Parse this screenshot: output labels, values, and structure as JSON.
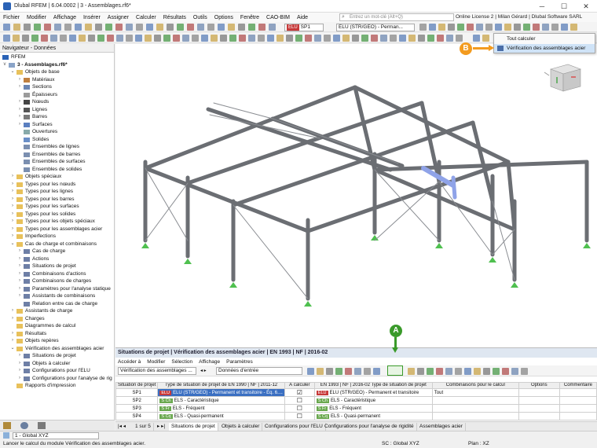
{
  "title": "Dlubal RFEM | 6.04.0002 | 3 - Assemblages.rf6*",
  "menu": [
    "Fichier",
    "Modifier",
    "Affichage",
    "Insérer",
    "Assigner",
    "Calculer",
    "Résultats",
    "Outils",
    "Options",
    "Fenêtre",
    "CAO-BIM",
    "Aide"
  ],
  "search_placeholder": "Entrez un mot-clé (Alt+Q)",
  "license": "Online License 2 | Milan Gérard | Dlubal Software SARL",
  "toolbar": {
    "loadcase_badge": "ELU",
    "loadcase_code": "SP1",
    "loadcase_name": "ELU (STR/GEO) - Perman..."
  },
  "popup": {
    "item1": "Tout calculer",
    "item2": "Vérification des assemblages acier"
  },
  "callouts": {
    "a": "A",
    "b": "B"
  },
  "navigator": {
    "title": "Navigateur - Données",
    "root": "RFEM",
    "file": "3 - Assemblages.rf6*",
    "items": [
      {
        "label": "Objets de base",
        "lvl": 1,
        "ex": "v",
        "ic": "folder"
      },
      {
        "label": "Matériaux",
        "lvl": 2,
        "ex": ">",
        "ic": "mat"
      },
      {
        "label": "Sections",
        "lvl": 2,
        "ex": ">",
        "ic": "sec"
      },
      {
        "label": "Épaisseurs",
        "lvl": 2,
        "ex": "",
        "ic": "thk"
      },
      {
        "label": "Nœuds",
        "lvl": 2,
        "ex": ">",
        "ic": "node"
      },
      {
        "label": "Lignes",
        "lvl": 2,
        "ex": ">",
        "ic": "line"
      },
      {
        "label": "Barres",
        "lvl": 2,
        "ex": ">",
        "ic": "bar"
      },
      {
        "label": "Surfaces",
        "lvl": 2,
        "ex": ">",
        "ic": "surf"
      },
      {
        "label": "Ouvertures",
        "lvl": 2,
        "ex": "",
        "ic": "open"
      },
      {
        "label": "Solides",
        "lvl": 2,
        "ex": "",
        "ic": "solid"
      },
      {
        "label": "Ensembles de lignes",
        "lvl": 2,
        "ex": "",
        "ic": "set"
      },
      {
        "label": "Ensembles de barres",
        "lvl": 2,
        "ex": "",
        "ic": "set"
      },
      {
        "label": "Ensembles de surfaces",
        "lvl": 2,
        "ex": "",
        "ic": "set"
      },
      {
        "label": "Ensembles de solides",
        "lvl": 2,
        "ex": "",
        "ic": "set"
      },
      {
        "label": "Objets spéciaux",
        "lvl": 1,
        "ex": ">",
        "ic": "folder"
      },
      {
        "label": "Types pour les nœuds",
        "lvl": 1,
        "ex": ">",
        "ic": "folder"
      },
      {
        "label": "Types pour les lignes",
        "lvl": 1,
        "ex": ">",
        "ic": "folder"
      },
      {
        "label": "Types pour les barres",
        "lvl": 1,
        "ex": ">",
        "ic": "folder"
      },
      {
        "label": "Types pour les surfaces",
        "lvl": 1,
        "ex": ">",
        "ic": "folder"
      },
      {
        "label": "Types pour les solides",
        "lvl": 1,
        "ex": ">",
        "ic": "folder"
      },
      {
        "label": "Types pour les objets spéciaux",
        "lvl": 1,
        "ex": ">",
        "ic": "folder"
      },
      {
        "label": "Types pour les assemblages acier",
        "lvl": 1,
        "ex": ">",
        "ic": "folder"
      },
      {
        "label": "Imperfections",
        "lvl": 1,
        "ex": ">",
        "ic": "folder"
      },
      {
        "label": "Cas de charge et combinaisons",
        "lvl": 1,
        "ex": "v",
        "ic": "folder"
      },
      {
        "label": "Cas de charge",
        "lvl": 2,
        "ex": ">",
        "ic": "lc"
      },
      {
        "label": "Actions",
        "lvl": 2,
        "ex": ">",
        "ic": "lc"
      },
      {
        "label": "Situations de projet",
        "lvl": 2,
        "ex": ">",
        "ic": "lc"
      },
      {
        "label": "Combinaisons d'actions",
        "lvl": 2,
        "ex": ">",
        "ic": "lc"
      },
      {
        "label": "Combinaisons de charges",
        "lvl": 2,
        "ex": ">",
        "ic": "lc"
      },
      {
        "label": "Paramètres pour l'analyse statique",
        "lvl": 2,
        "ex": ">",
        "ic": "lc"
      },
      {
        "label": "Assistants de combinaisons",
        "lvl": 2,
        "ex": ">",
        "ic": "lc"
      },
      {
        "label": "Relation entre cas de charge",
        "lvl": 2,
        "ex": "",
        "ic": "lc"
      },
      {
        "label": "Assistants de charge",
        "lvl": 1,
        "ex": ">",
        "ic": "folder"
      },
      {
        "label": "Charges",
        "lvl": 1,
        "ex": ">",
        "ic": "folder"
      },
      {
        "label": "Diagrammes de calcul",
        "lvl": 1,
        "ex": "",
        "ic": "folder"
      },
      {
        "label": "Résultats",
        "lvl": 1,
        "ex": ">",
        "ic": "folder"
      },
      {
        "label": "Objets repères",
        "lvl": 1,
        "ex": ">",
        "ic": "folder"
      },
      {
        "label": "Vérification des assemblages acier",
        "lvl": 1,
        "ex": "v",
        "ic": "folder"
      },
      {
        "label": "Situations de projet",
        "lvl": 2,
        "ex": ">",
        "ic": "lc"
      },
      {
        "label": "Objets à calculer",
        "lvl": 2,
        "ex": ">",
        "ic": "lc"
      },
      {
        "label": "Configurations pour l'ELU",
        "lvl": 2,
        "ex": ">",
        "ic": "lc"
      },
      {
        "label": "Configurations pour l'analyse de rig",
        "lvl": 2,
        "ex": ">",
        "ic": "lc"
      },
      {
        "label": "Rapports d'impression",
        "lvl": 1,
        "ex": "",
        "ic": "folder"
      }
    ]
  },
  "panel": {
    "title": "Situations de projet | Vérification des assemblages acier | EN 1993 | NF | 2016-02",
    "menu": [
      "Accéder à",
      "Modifier",
      "Sélection",
      "Affichage",
      "Paramètres"
    ],
    "module_combo": "Vérification des assemblages ...",
    "data_combo": "Données d'entrée",
    "headers": [
      "Situation de projet",
      "Type de situation de projet de EN 1990 | NF | 2011-12",
      "À calculer",
      "EN 1993 | NF | 2016-02 Type de situation de projet",
      "Combinaisons pour le calcul",
      "Options",
      "Commentaire"
    ],
    "rows": [
      {
        "id": "SP1",
        "chip": "ELU",
        "chipcolor": "#c73a3a",
        "type": "ELU (STR/GEO) - Permanent et transitoire - Éq. 6....",
        "check": "☑",
        "chip2": "ELU",
        "type2": "ELU (STR/GEO) - Permanent et transitoire",
        "comb": "Tout"
      },
      {
        "id": "SP2",
        "chip": "S Ch",
        "chipcolor": "#6aa84f",
        "type": "ELS - Caractéristique",
        "check": "☐",
        "chip2": "S Ch",
        "type2": "ELS - Caractéristique",
        "comb": ""
      },
      {
        "id": "SP3",
        "chip": "S Fr",
        "chipcolor": "#6aa84f",
        "type": "ELS - Fréquent",
        "check": "☐",
        "chip2": "S Fr",
        "type2": "ELS - Fréquent",
        "comb": ""
      },
      {
        "id": "SP4",
        "chip": "S Cq",
        "chipcolor": "#6aa84f",
        "type": "ELS - Quasi-permanent",
        "check": "☐",
        "chip2": "S Cq",
        "type2": "ELS - Quasi-permanent",
        "comb": ""
      }
    ],
    "pager": "1 sur 5",
    "tabs": [
      "Situations de projet",
      "Objets à calculer",
      "Configurations pour l'ELU",
      "Configurations pour l'analyse de rigidité",
      "Assemblages acier"
    ]
  },
  "status": {
    "left": "1 - Global XYZ",
    "msg": "Lancer le calcul du module Vérification des assemblages acier.",
    "sc": "SC : Global XYZ",
    "plan": "Plan : XZ"
  },
  "colors": {
    "accent_a": "#3a9a2a",
    "accent_b": "#f39b1f",
    "highlight": "#cfe3f7"
  }
}
